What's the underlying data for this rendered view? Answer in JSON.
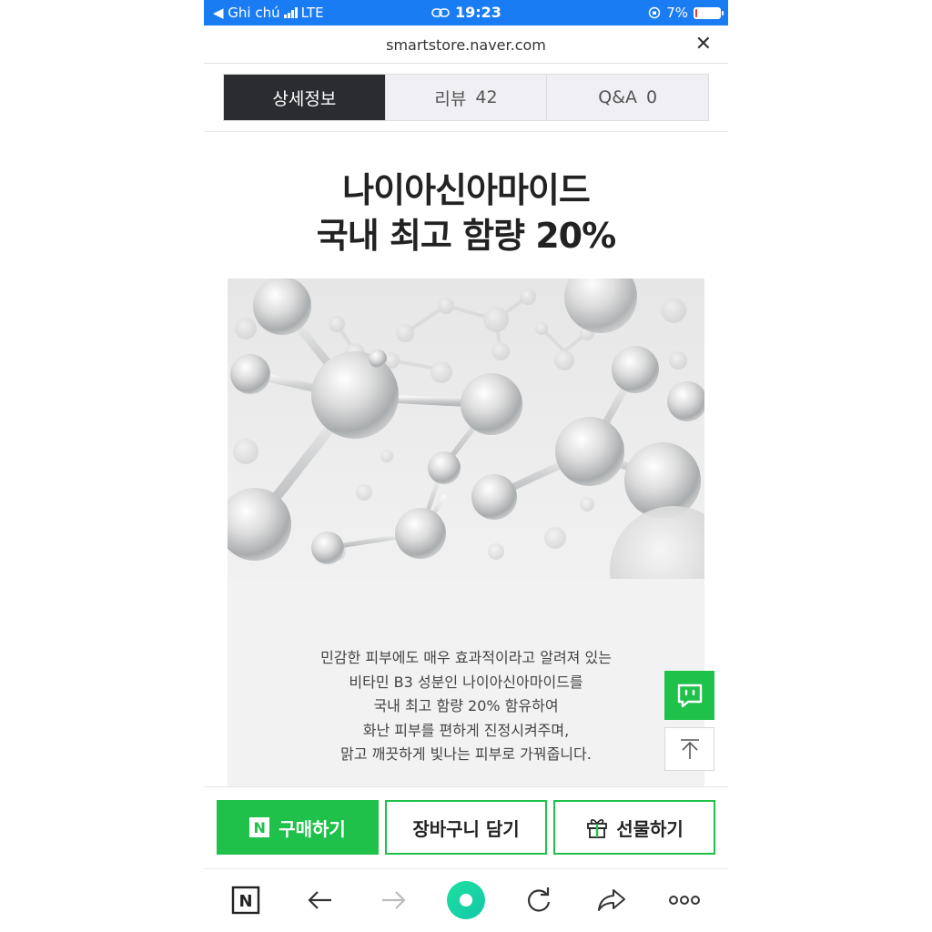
{
  "status_bar": {
    "back_app": "◀ Ghi chú",
    "carrier": "LTE",
    "time": "19:23",
    "battery": "7%",
    "battery_level": 0.07
  },
  "address_bar": {
    "url": "smartstore.naver.com",
    "close_icon": "close-icon"
  },
  "tabs": [
    {
      "label": "상세정보",
      "count": ""
    },
    {
      "label": "리뷰",
      "count": "42"
    },
    {
      "label": "Q&A",
      "count": "0"
    }
  ],
  "headline": {
    "line1": "나이아신아마이드",
    "line2": "국내 최고 함량 20%"
  },
  "description": [
    "민감한 피부에도 매우 효과적이라고 알려져 있는",
    "비타민 B3 성분인 나이아신아마이드를",
    "국내 최고 함량 20% 함유하여",
    "화난 피부를 편하게 진정시켜주며,",
    "맑고 깨끗하게 빛나는 피부로 가꿔줍니다."
  ],
  "buy_bar": {
    "logo": "N",
    "buy": "구매하기",
    "cart": "장바구니 담기",
    "gift": "선물하기"
  },
  "colors": {
    "status_bar": "#1a7cf3",
    "naver_green": "#1fc14a",
    "active_tab": "#2b2c30"
  }
}
